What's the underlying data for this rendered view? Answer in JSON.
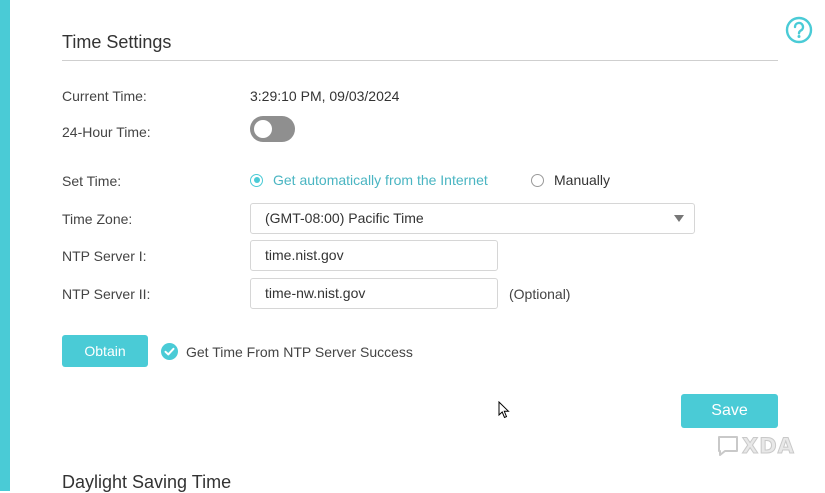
{
  "help": {
    "icon": "question-circle-icon"
  },
  "time_settings": {
    "title": "Time Settings",
    "current_time": {
      "label": "Current Time:",
      "value": "3:29:10 PM, 09/03/2024"
    },
    "hour24": {
      "label": "24-Hour Time:",
      "enabled": false
    },
    "set_time": {
      "label": "Set Time:",
      "options": [
        {
          "label": "Get automatically from the Internet",
          "selected": true
        },
        {
          "label": "Manually",
          "selected": false
        }
      ]
    },
    "time_zone": {
      "label": "Time Zone:",
      "value": "(GMT-08:00) Pacific Time"
    },
    "ntp1": {
      "label": "NTP Server I:",
      "value": "time.nist.gov"
    },
    "ntp2": {
      "label": "NTP Server II:",
      "value": "time-nw.nist.gov",
      "hint": "(Optional)"
    },
    "obtain_button": "Obtain",
    "status_message": "Get Time From NTP Server Success",
    "save_button": "Save"
  },
  "daylight": {
    "title": "Daylight Saving Time"
  },
  "watermark": {
    "text": "XDA"
  },
  "colors": {
    "accent": "#4acbd6",
    "toggle_off": "#8f8f8f",
    "text": "#333333"
  }
}
